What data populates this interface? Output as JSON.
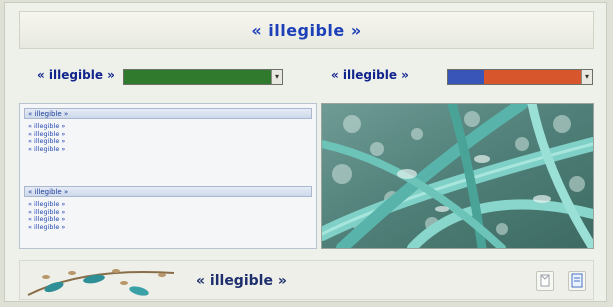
{
  "header": {
    "title": "« illegible »"
  },
  "selectors": {
    "left": {
      "label": "« illegible »",
      "value": "",
      "fill_color": "#2f7a2d"
    },
    "right": {
      "label": "« illegible »",
      "value": "",
      "fill_color": "#d7562c"
    }
  },
  "info_panel": {
    "section1": {
      "heading": "« illegible »",
      "lines": [
        "« illegible »",
        "« illegible »",
        "« illegible »",
        "« illegible »"
      ]
    },
    "section2": {
      "heading": "« illegible »",
      "lines": [
        "« illegible »",
        "« illegible »",
        "« illegible »",
        "« illegible »"
      ]
    }
  },
  "image_panel": {
    "subject": "leaf-damage-photo"
  },
  "footer": {
    "label": "« illegible »",
    "icon_names": [
      "prev-page-icon",
      "next-page-icon"
    ]
  },
  "colors": {
    "title": "#1d3fb8",
    "panel_text": "#2548b0",
    "accent_green": "#2f7a2d",
    "accent_orange": "#d7562c"
  }
}
